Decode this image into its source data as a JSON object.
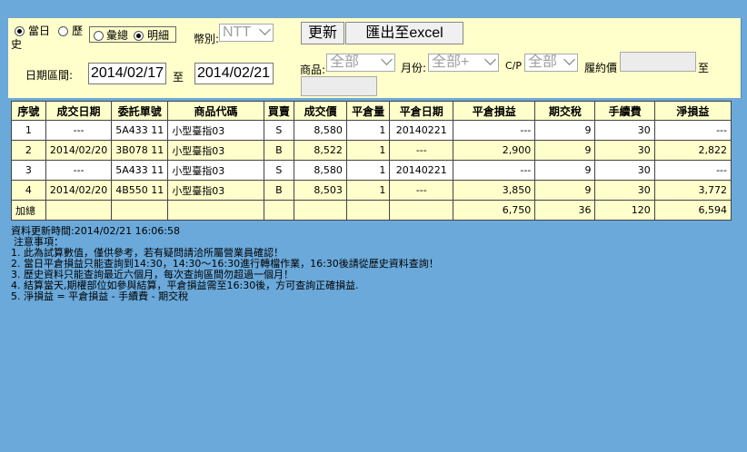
{
  "filters": {
    "radio_today": "當日",
    "radio_history": "歷",
    "radio_history_wrap": "史",
    "radio_summary": "彙總",
    "radio_detail": "明細",
    "currency_label": "幣別:",
    "currency_value": "NTT",
    "date_range_label": "日期區間:",
    "date_from": "2014/02/17",
    "date_to_label": "至",
    "date_to": "2014/02/21",
    "refresh_label": "更新",
    "export_label": "匯出至excel",
    "product_label": "商品:",
    "product_value": "全部",
    "month_label": "月份:",
    "month_value": "全部+",
    "cp_label": "C/P",
    "cp_value": "全部",
    "strike_label": "履約價",
    "strike_to_label": "至"
  },
  "table": {
    "headers": [
      "序號",
      "成交日期",
      "委託單號",
      "商品代碼",
      "買賣",
      "成交價",
      "平倉量",
      "平倉日期",
      "平倉損益",
      "期交稅",
      "手續費",
      "淨損益"
    ],
    "rows": [
      [
        "1",
        "---",
        "5A433 11",
        "小型臺指03",
        "S",
        "8,580",
        "1",
        "20140221",
        "---",
        "9",
        "30",
        "---"
      ],
      [
        "2",
        "2014/02/20",
        "3B078 11",
        "小型臺指03",
        "B",
        "8,522",
        "1",
        "---",
        "2,900",
        "9",
        "30",
        "2,822"
      ],
      [
        "3",
        "---",
        "5A433 11",
        "小型臺指03",
        "S",
        "8,580",
        "1",
        "20140221",
        "---",
        "9",
        "30",
        "---"
      ],
      [
        "4",
        "2014/02/20",
        "4B550 11",
        "小型臺指03",
        "B",
        "8,503",
        "1",
        "---",
        "3,850",
        "9",
        "30",
        "3,772"
      ]
    ],
    "total": [
      "加總",
      "",
      "",
      "",
      "",
      "",
      "",
      "",
      "6,750",
      "36",
      "120",
      "6,594"
    ]
  },
  "notes": {
    "updated": "資料更新時間:2014/02/21 16:06:58",
    "heading": "注意事項：",
    "items": [
      "1. 此為試算數值，僅供參考，若有疑問請洽所屬營業員確認！",
      "2. 當日平倉損益只能查詢到14:30，14:30～16:30進行轉檔作業，16:30後請從歷史資料查詢！",
      "3. 歷史資料只能查詢最近六個月，每次查詢區間勿超過一個月！",
      "4. 結算當天,期權部位如參與結算，平倉損益需至16:30後，方可查詢正確損益.",
      "5. 淨損益 = 平倉損益 - 手續費 - 期交稅"
    ]
  }
}
